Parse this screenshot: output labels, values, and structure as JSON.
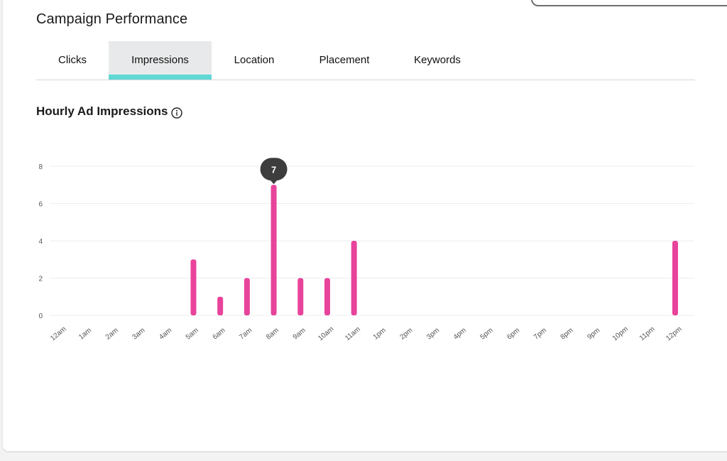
{
  "page": {
    "title": "Campaign Performance"
  },
  "tabs": [
    {
      "label": "Clicks",
      "active": false
    },
    {
      "label": "Impressions",
      "active": true
    },
    {
      "label": "Location",
      "active": false
    },
    {
      "label": "Placement",
      "active": false
    },
    {
      "label": "Keywords",
      "active": false
    }
  ],
  "section": {
    "title": "Hourly Ad Impressions",
    "info_icon": "info-icon"
  },
  "colors": {
    "bar": "#e8439b",
    "tab_accent": "#5fd8d6",
    "tooltip_bg": "#3d3d3d"
  },
  "chart_data": {
    "type": "bar",
    "title": "",
    "xlabel": "",
    "ylabel": "",
    "ylim": [
      0,
      8
    ],
    "yticks": [
      0,
      2,
      4,
      6,
      8
    ],
    "grid": true,
    "categories": [
      "12am",
      "1am",
      "2am",
      "3am",
      "4am",
      "5am",
      "6am",
      "7am",
      "8am",
      "9am",
      "10am",
      "11am",
      "1pm",
      "2pm",
      "3pm",
      "4pm",
      "5pm",
      "6pm",
      "7pm",
      "8pm",
      "9pm",
      "10pm",
      "11pm",
      "12pm"
    ],
    "values": [
      0,
      0,
      0,
      0,
      0,
      3,
      1,
      2,
      7,
      2,
      2,
      4,
      0,
      0,
      0,
      0,
      0,
      0,
      0,
      0,
      0,
      0,
      0,
      4
    ],
    "tooltip": {
      "category": "8am",
      "value": "7"
    }
  }
}
